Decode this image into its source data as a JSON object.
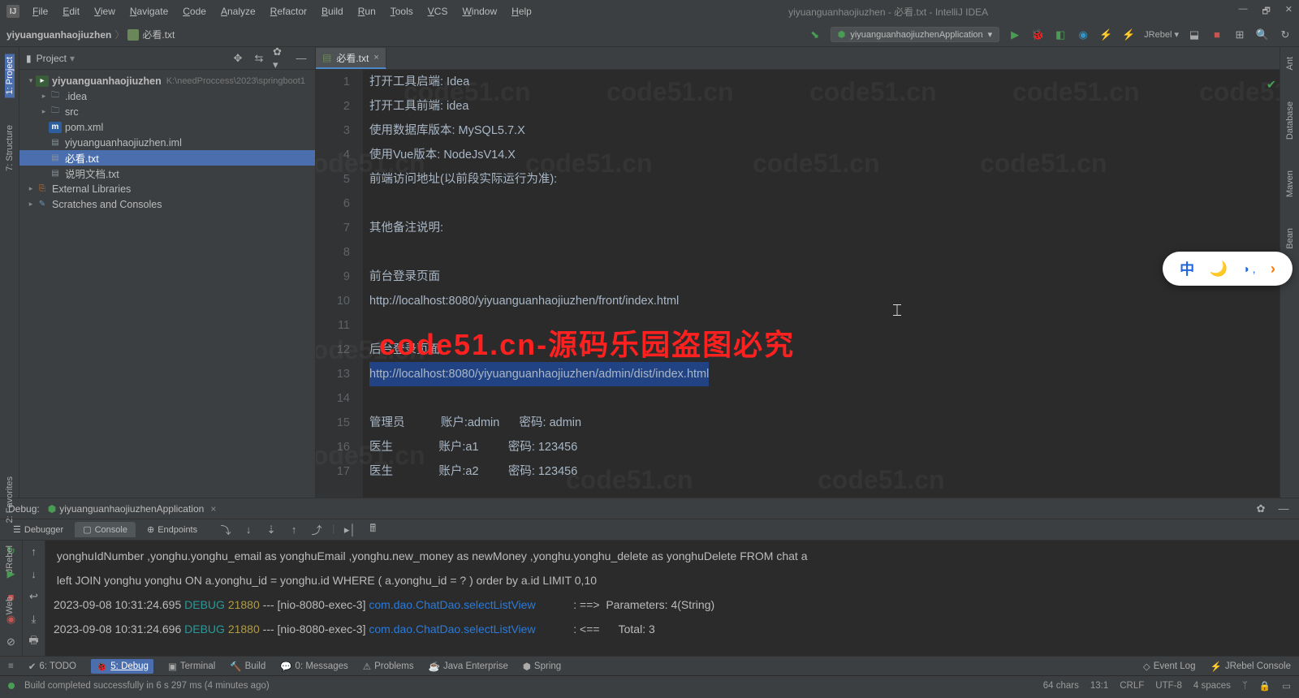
{
  "window": {
    "title": "yiyuanguanhaojiuzhen - 必看.txt - IntelliJ IDEA",
    "logo": "IJ"
  },
  "menu": [
    "File",
    "Edit",
    "View",
    "Navigate",
    "Code",
    "Analyze",
    "Refactor",
    "Build",
    "Run",
    "Tools",
    "VCS",
    "Window",
    "Help"
  ],
  "breadcrumb": {
    "root": "yiyuanguanhaojiuzhen",
    "file": "必看.txt"
  },
  "run_config": "yiyuanguanhaojiuzhenApplication",
  "project_panel": {
    "title": "Project"
  },
  "tree": {
    "root": "yiyuanguanhaojiuzhen",
    "root_hint": "K:\\needProccess\\2023\\springboot1",
    "items": [
      {
        "indent": 1,
        "arrow": "▸",
        "icon": "folder",
        "label": ".idea"
      },
      {
        "indent": 1,
        "arrow": "▸",
        "icon": "folder",
        "label": "src"
      },
      {
        "indent": 1,
        "arrow": "",
        "icon": "m",
        "label": "pom.xml"
      },
      {
        "indent": 1,
        "arrow": "",
        "icon": "file",
        "label": "yiyuanguanhaojiuzhen.iml"
      },
      {
        "indent": 1,
        "arrow": "",
        "icon": "file",
        "label": "必看.txt",
        "selected": true
      },
      {
        "indent": 1,
        "arrow": "",
        "icon": "file",
        "label": "说明文档.txt"
      }
    ],
    "ext_lib": "External Libraries",
    "scratches": "Scratches and Consoles"
  },
  "left_tabs": [
    "1: Project",
    "7: Structure"
  ],
  "right_tabs": [
    "Ant",
    "Database",
    "Maven",
    "Bean"
  ],
  "editor": {
    "tab_label": "必看.txt",
    "lines": [
      {
        "n": 1,
        "text": "打开工具启端: Idea"
      },
      {
        "n": 2,
        "text": "打开工具前端: idea"
      },
      {
        "n": 3,
        "text": "使用数据库版本: MySQL5.7.X"
      },
      {
        "n": 4,
        "text": "使用Vue版本: NodeJsV14.X"
      },
      {
        "n": 5,
        "text": "前端访问地址(以前段实际运行为准):"
      },
      {
        "n": 6,
        "text": ""
      },
      {
        "n": 7,
        "text": "其他备注说明:"
      },
      {
        "n": 8,
        "text": ""
      },
      {
        "n": 9,
        "text": "前台登录页面"
      },
      {
        "n": 10,
        "text": "http://localhost:8080/yiyuanguanhaojiuzhen/front/index.html"
      },
      {
        "n": 11,
        "text": ""
      },
      {
        "n": 12,
        "text": "后台登录页面"
      },
      {
        "n": 13,
        "text": "http://localhost:8080/yiyuanguanhaojiuzhen/admin/dist/index.html",
        "selected": true
      },
      {
        "n": 14,
        "text": ""
      },
      {
        "n": 15,
        "text": "管理员           账户:admin      密码: admin"
      },
      {
        "n": 16,
        "text": "医生              账户:a1         密码: 123456"
      },
      {
        "n": 17,
        "text": "医生              账户:a2         密码: 123456"
      }
    ]
  },
  "overlay_red": "code51.cn-源码乐园盗图必究",
  "watermark": "code51.cn",
  "debug": {
    "title": "Debug:",
    "app": "yiyuanguanhaojiuzhenApplication",
    "tabs": [
      "Debugger",
      "Console",
      "Endpoints"
    ],
    "active_tab": 1,
    "console_lines": [
      {
        "raw": " yonghuIdNumber ,yonghu.yonghu_email as yonghuEmail ,yonghu.new_money as newMoney ,yonghu.yonghu_delete as yonghuDelete FROM chat a"
      },
      {
        "raw": " left JOIN yonghu yonghu ON a.yonghu_id = yonghu.id WHERE ( a.yonghu_id = ? ) order by a.id LIMIT 0,10"
      },
      {
        "ts": "2023-09-08 10:31:24.695",
        "level": "DEBUG",
        "pid": "21880",
        "thread": "[nio-8080-exec-3]",
        "cls": "com.dao.ChatDao.selectListView",
        "msg": ": ==>  Parameters: 4(String)"
      },
      {
        "ts": "2023-09-08 10:31:24.696",
        "level": "DEBUG",
        "pid": "21880",
        "thread": "[nio-8080-exec-3]",
        "cls": "com.dao.ChatDao.selectListView",
        "msg": ": <==      Total: 3"
      }
    ]
  },
  "bottom_tabs": {
    "todo": "6: TODO",
    "debug": "5: Debug",
    "terminal": "Terminal",
    "build": "Build",
    "messages": "0: Messages",
    "problems": "Problems",
    "java_ee": "Java Enterprise",
    "spring": "Spring",
    "event_log": "Event Log",
    "jrebel": "JRebel Console"
  },
  "status": {
    "msg": "Build completed successfully in 6 s 297 ms (4 minutes ago)",
    "chars": "64 chars",
    "pos": "13:1",
    "crlf": "CRLF",
    "enc": "UTF-8",
    "indent": "4 spaces"
  },
  "float": {
    "a": "中",
    "c": "◑ ,"
  }
}
